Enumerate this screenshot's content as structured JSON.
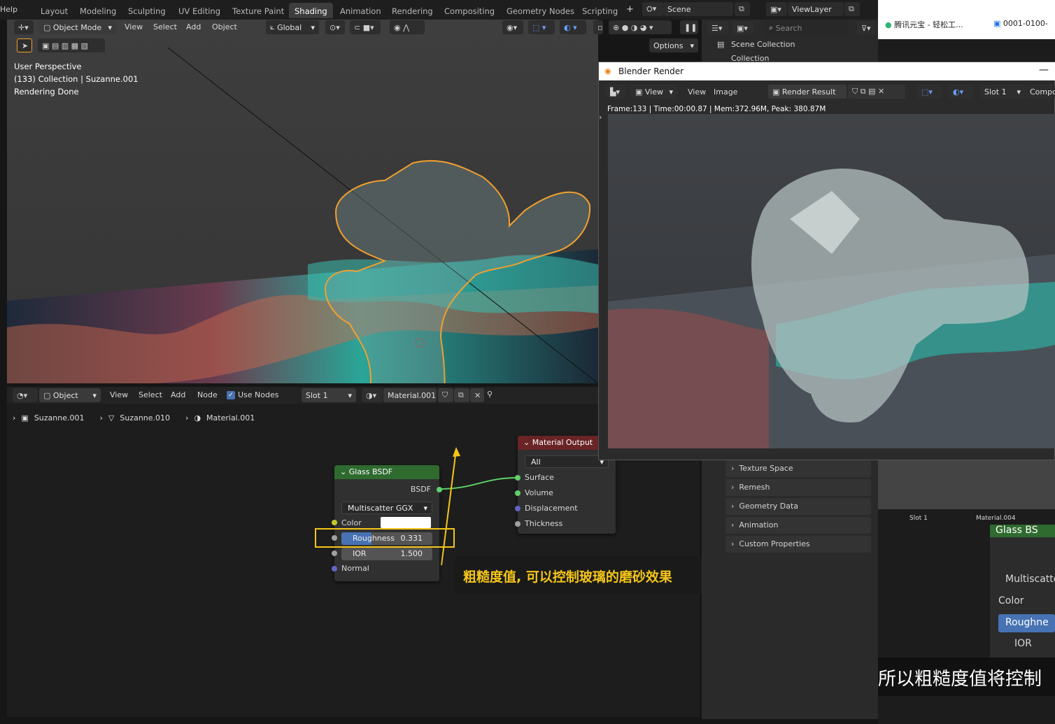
{
  "topbar": {
    "help": "Help",
    "tabs": [
      "Layout",
      "Modeling",
      "Sculpting",
      "UV Editing",
      "Texture Paint",
      "Shading",
      "Animation",
      "Rendering",
      "Compositing",
      "Geometry Nodes",
      "Scripting"
    ],
    "active_tab": "Shading",
    "add_tab": "+",
    "scene": "Scene",
    "viewlayer": "ViewLayer"
  },
  "viewport": {
    "mode": "Object Mode",
    "menu": [
      "View",
      "Select",
      "Add",
      "Object"
    ],
    "orientation": "Global",
    "options": "Options",
    "info_line1": "User Perspective",
    "info_line2": "(133) Collection | Suzanne.001",
    "info_line3": "Rendering Done"
  },
  "outliner": {
    "search_placeholder": "Search",
    "scene_collection": "Scene Collection",
    "collection": "Collection"
  },
  "render_window": {
    "title": "Blender Render",
    "menu": [
      "View",
      "View",
      "Image"
    ],
    "result": "Render Result",
    "slot": "Slot 1",
    "compo": "Compo",
    "stats": "Frame:133 | Time:00:00.87 | Mem:372.96M, Peak: 380.87M"
  },
  "node_editor": {
    "type": "Object",
    "menu": [
      "View",
      "Select",
      "Add",
      "Node"
    ],
    "use_nodes": "Use Nodes",
    "slot": "Slot 1",
    "material": "Material.001",
    "breadcrumb": [
      "Suzanne.001",
      "Suzanne.010",
      "Material.001"
    ]
  },
  "glass_node": {
    "title": "Glass BSDF",
    "output": "BSDF",
    "distribution": "Multiscatter GGX",
    "color_label": "Color",
    "roughness_label": "Roughness",
    "roughness_value": "0.331",
    "roughness_fraction": 0.331,
    "ior_label": "IOR",
    "ior_value": "1.500",
    "normal_label": "Normal"
  },
  "output_node": {
    "title": "Material Output",
    "target": "All",
    "inputs": [
      "Surface",
      "Volume",
      "Displacement",
      "Thickness"
    ]
  },
  "annotation": "粗糙度值, 可以控制玻璃的磨砂效果",
  "properties": {
    "rows": [
      "Texture Space",
      "Remesh",
      "Geometry Data",
      "Animation",
      "Custom Properties"
    ]
  },
  "right_strip": {
    "browser_tab1": "腾讯元宝 - 轻松工...",
    "browser_tab2": "0001-0100-",
    "slot": "Slot 1",
    "material": "Material.004",
    "node_title": "Glass BS",
    "multiscatter": "Multiscatte",
    "color": "Color",
    "roughness": "Roughne",
    "ior": "IOR",
    "subtitle": "所以粗糙度值将控制"
  },
  "colors": {
    "accent_blue": "#4772b3",
    "glass_header": "#2f6a2f",
    "output_header": "#6a2426",
    "selection_orange": "#f0a030",
    "annotation_yellow": "#f5c518"
  }
}
